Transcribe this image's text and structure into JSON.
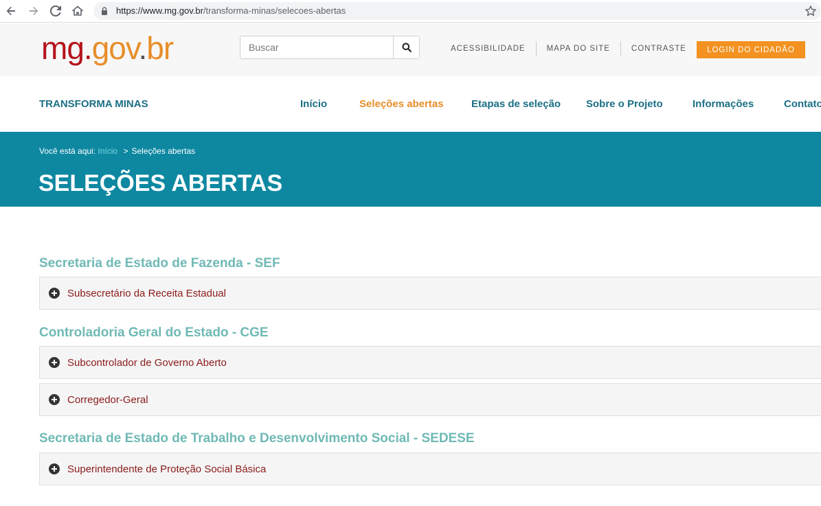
{
  "browser": {
    "url_host": "https://www.mg.gov.br",
    "url_path": "/transforma-minas/selecoes-abertas"
  },
  "header": {
    "logo_part1": "mg.",
    "logo_part2": "gov",
    "logo_dot": ".",
    "logo_part3": "br",
    "search_placeholder": "Buscar",
    "util_links": [
      "ACESSIBILIDADE",
      "MAPA DO SITE",
      "CONTRASTE"
    ],
    "login_label": "LOGIN DO CIDADÃO"
  },
  "nav": {
    "brand": "TRANSFORMA MINAS",
    "items": [
      "Início",
      "Seleções abertas",
      "Etapas de seleção",
      "Sobre o Projeto",
      "Informações",
      "Contato"
    ]
  },
  "banner": {
    "breadcrumb_prefix": "Você está aqui:",
    "breadcrumb_home": "Início",
    "breadcrumb_sep": ">",
    "breadcrumb_current": "Seleções abertas",
    "title": "SELEÇÕES ABERTAS"
  },
  "sections": [
    {
      "title": "Secretaria de Estado de Fazenda - SEF",
      "items": [
        "Subsecretário da Receita Estadual"
      ]
    },
    {
      "title": "Controladoria Geral do Estado - CGE",
      "items": [
        "Subcontrolador de Governo Aberto",
        "Corregedor-Geral"
      ]
    },
    {
      "title": "Secretaria de Estado de Trabalho e Desenvolvimento Social - SEDESE",
      "items": [
        "Superintendente de Proteção Social Básica"
      ]
    }
  ],
  "colors": {
    "accent_orange": "#f39220",
    "banner_teal": "#0e88a1",
    "nav_text": "#1b6f85",
    "section_title": "#6fb9b5",
    "item_text": "#8b1a1a"
  }
}
